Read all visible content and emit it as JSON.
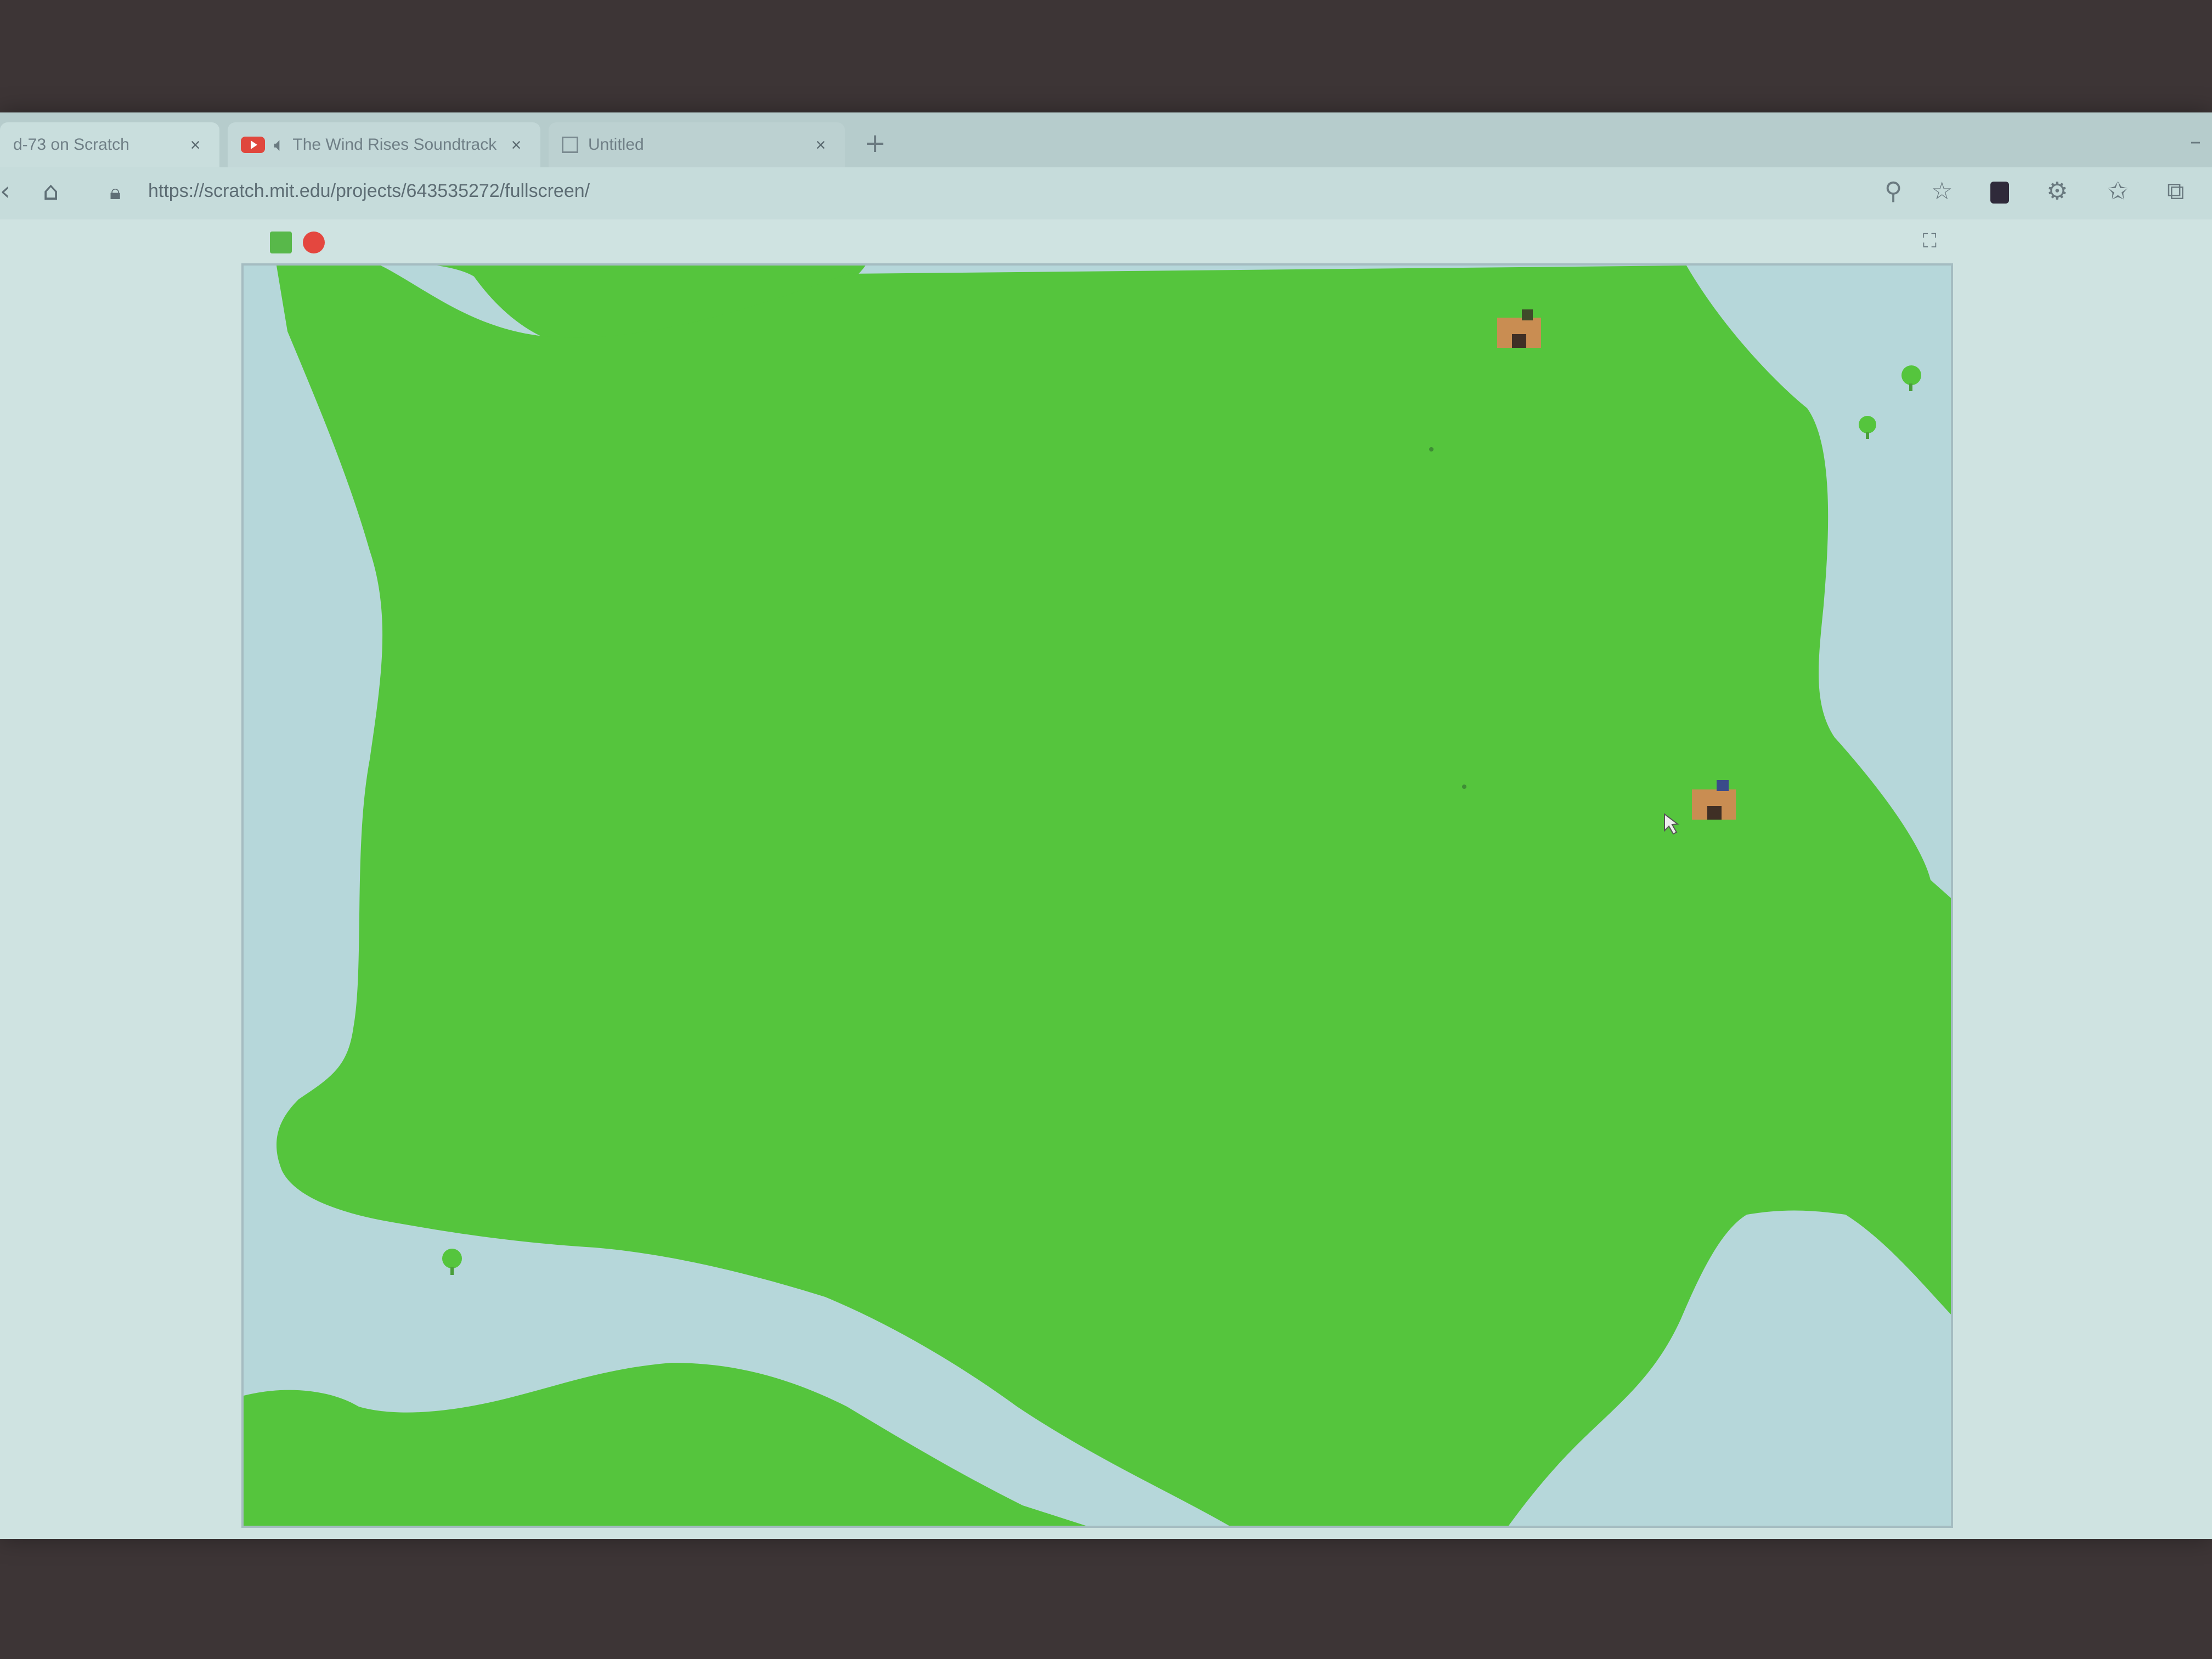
{
  "tabs": [
    {
      "title": "d-73 on Scratch",
      "close": "×"
    },
    {
      "title": "The Wind Rises Soundtrack",
      "close": "×"
    },
    {
      "title": "Untitled",
      "close": "×"
    }
  ],
  "tab_newtab": "+",
  "address": {
    "url": "https://scratch.mit.edu/projects/643535272/fullscreen/"
  },
  "icons": {
    "back": "back-arrow-icon",
    "home": "home-icon",
    "lock": "lock-icon",
    "zoom": "zoom-icon",
    "extensions": "puzzle-icon",
    "settings": "gear-icon",
    "favorites": "star-icon",
    "collections": "collections-icon"
  },
  "stage": {
    "green_flag": "green-flag-icon",
    "stop": "stop-sign-icon",
    "fullscreen": "fullscreen-exit-icon"
  },
  "colors": {
    "land": "#55c53d",
    "water": "#b6d7da",
    "house_roof": "#c98d52",
    "house_door": "#3a4b8a"
  }
}
